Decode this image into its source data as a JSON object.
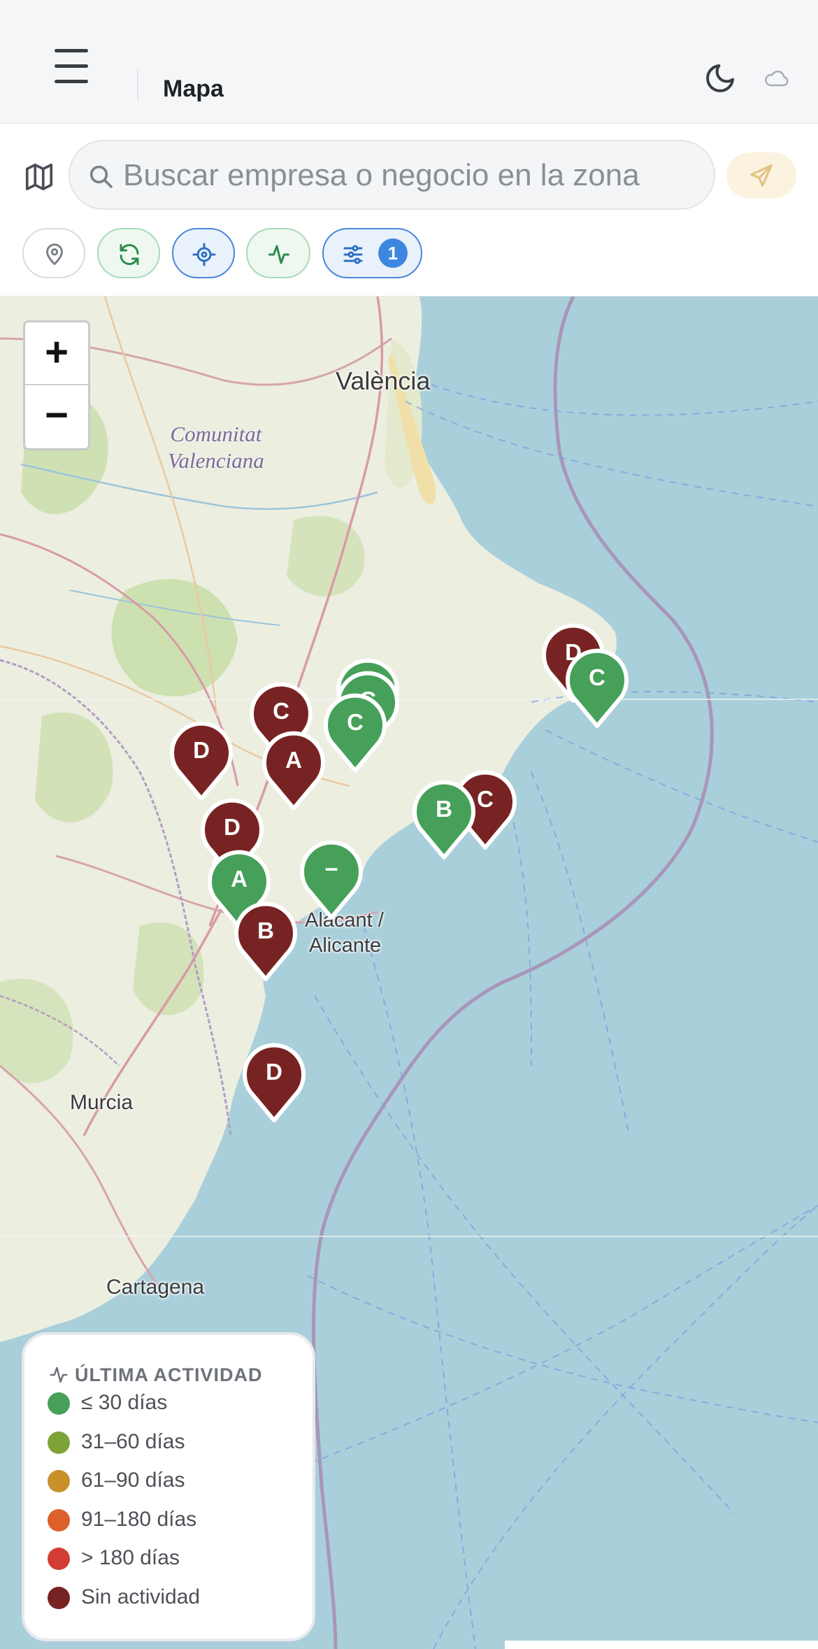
{
  "header": {
    "title": "Mapa"
  },
  "search": {
    "placeholder": "Buscar empresa o negocio en la zona"
  },
  "filters": {
    "active_count": "1"
  },
  "zoom": {
    "in_label": "+",
    "out_label": "−"
  },
  "map": {
    "cities": [
      "València",
      "Alacant /",
      "Alicante",
      "Murcia",
      "Cartagena"
    ],
    "region_line1": "Comunitat",
    "region_line2": "Valenciana",
    "markers": [
      {
        "label": "D",
        "status": "sin-actividad"
      },
      {
        "label": "C",
        "status": "le-30"
      },
      {
        "label": "C",
        "status": "sin-actividad"
      },
      {
        "label": "C",
        "status": "le-30"
      },
      {
        "label": "C",
        "status": "le-30"
      },
      {
        "label": "C",
        "status": "le-30"
      },
      {
        "label": "D",
        "status": "sin-actividad"
      },
      {
        "label": "A",
        "status": "sin-actividad"
      },
      {
        "label": "D",
        "status": "sin-actividad"
      },
      {
        "label": "C",
        "status": "sin-actividad"
      },
      {
        "label": "B",
        "status": "le-30"
      },
      {
        "label": "A",
        "status": "le-30"
      },
      {
        "label": "−",
        "status": "le-30"
      },
      {
        "label": "B",
        "status": "sin-actividad"
      },
      {
        "label": "D",
        "status": "sin-actividad"
      }
    ]
  },
  "legend": {
    "title": "ÚLTIMA ACTIVIDAD",
    "items": [
      {
        "label": "≤ 30 días",
        "color": "#46a05a"
      },
      {
        "label": "31–60 días",
        "color": "#7da336"
      },
      {
        "label": "61–90 días",
        "color": "#c9902c"
      },
      {
        "label": "91–180 días",
        "color": "#dd5f2a"
      },
      {
        "label": "> 180 días",
        "color": "#d23c33"
      },
      {
        "label": "Sin actividad",
        "color": "#782323"
      }
    ]
  },
  "colors": {
    "accent_blue": "#3d86e0",
    "marker_active": "#46a05a",
    "marker_inactive": "#782323"
  },
  "icons": [
    "menu-icon",
    "moon-icon",
    "cloud-icon",
    "map-icon",
    "search-icon",
    "send-icon",
    "location-pin-icon",
    "refresh-icon",
    "crosshair-icon",
    "activity-icon",
    "sliders-icon"
  ]
}
